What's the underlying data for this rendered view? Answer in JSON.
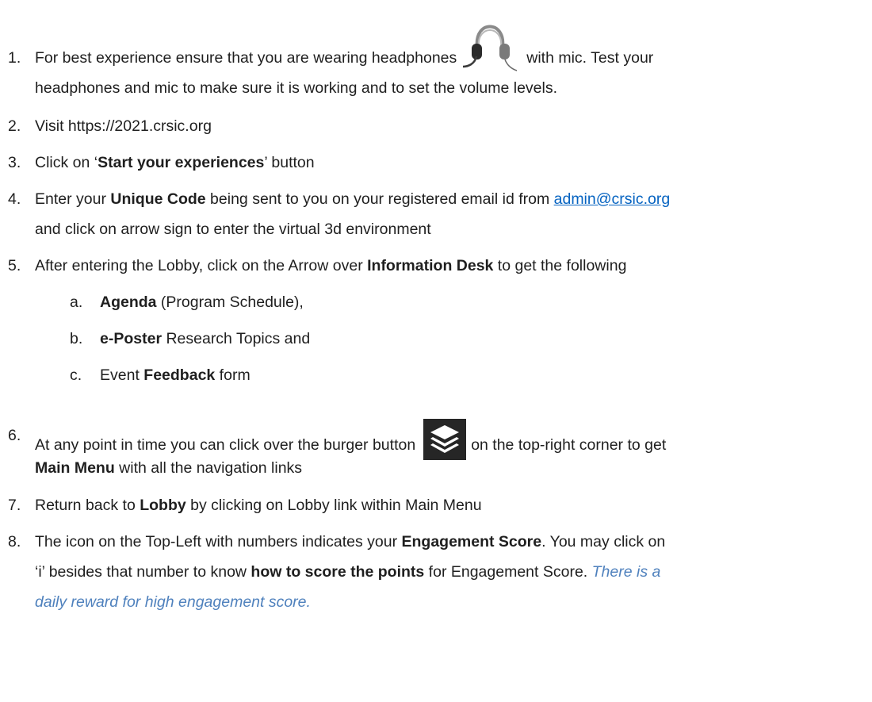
{
  "steps": [
    {
      "num": "1.",
      "lines": [
        [
          "For best experience ensure that you are wearing headphones",
          "with mic. Test your"
        ],
        "headphones and mic to make sure it is working and to set the volume levels."
      ]
    },
    {
      "num": "2.",
      "text": "Visit https://2021.crsic.org"
    },
    {
      "num": "3.",
      "pre": "Click on ‘",
      "bold": "Start your experiences",
      "post": "’ button"
    },
    {
      "num": "4.",
      "pre": "Enter your ",
      "bold": "Unique Code",
      "mid": " being sent to you on your registered email id from ",
      "email": "admin@crsic.org",
      "line2": "and click on arrow sign to enter the virtual 3d environment"
    },
    {
      "num": "5.",
      "pre": "After entering the Lobby, click on the Arrow over ",
      "bold": "Information Desk",
      "post": " to get the following",
      "subs": [
        {
          "num": "a.",
          "bold": "Agenda",
          "post": " (Program Schedule),"
        },
        {
          "num": "b.",
          "bold": "e-Poster",
          "post": " Research Topics and"
        },
        {
          "num": "c.",
          "pre": "Event ",
          "bold": "Feedback",
          "post": " form"
        }
      ]
    },
    {
      "num": "6.",
      "pre": "At any point in time you can click over the burger button",
      "post": "on the top-right corner to get",
      "line2_bold": "Main Menu",
      "line2_post": " with all the navigation links"
    },
    {
      "num": "7.",
      "pre": "Return back to ",
      "bold": "Lobby",
      "post": " by clicking on Lobby link within Main Menu"
    },
    {
      "num": "8.",
      "pre": "The icon on the Top-Left with numbers indicates your ",
      "bold": "Engagement Score",
      "post": ". You may click on",
      "line2_pre": "‘i’ besides that number to know ",
      "line2_bold": "how to score the points",
      "line2_post": " for Engagement Score. ",
      "line2_note": "There is a",
      "line3_note": "daily reward for high engagement score."
    }
  ]
}
